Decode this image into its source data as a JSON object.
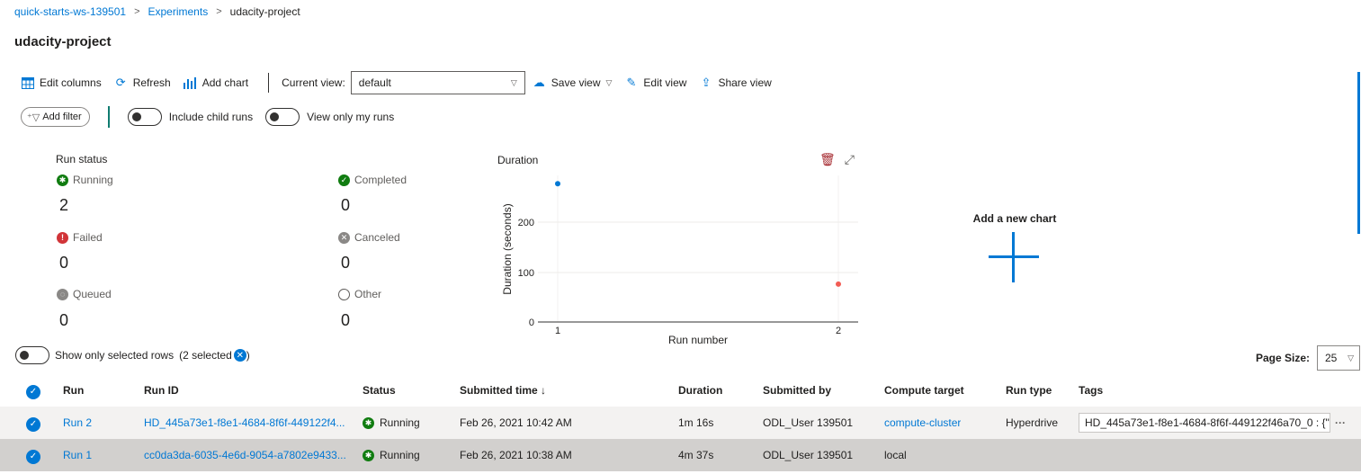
{
  "breadcrumb": {
    "workspace": "quick-starts-ws-139501",
    "experiments": "Experiments",
    "current": "udacity-project"
  },
  "page_title": "udacity-project",
  "toolbar": {
    "edit_columns": "Edit columns",
    "refresh": "Refresh",
    "add_chart": "Add chart",
    "current_view_label": "Current view:",
    "current_view_value": "default",
    "save_view": "Save view",
    "edit_view": "Edit view",
    "share_view": "Share view"
  },
  "filterbar": {
    "add_filter": "Add filter",
    "include_child_runs": "Include child runs",
    "view_only_my_runs": "View only my runs"
  },
  "run_status": {
    "title": "Run status",
    "running_label": "Running",
    "running_count": "2",
    "completed_label": "Completed",
    "completed_count": "0",
    "failed_label": "Failed",
    "failed_count": "0",
    "canceled_label": "Canceled",
    "canceled_count": "0",
    "queued_label": "Queued",
    "queued_count": "0",
    "other_label": "Other",
    "other_count": "0"
  },
  "duration_chart": {
    "title": "Duration",
    "ylabel": "Duration (seconds)",
    "xlabel": "Run number",
    "yticks": [
      "0",
      "100",
      "200"
    ],
    "xticks": [
      "1",
      "2"
    ]
  },
  "chart_data": {
    "type": "scatter",
    "title": "Duration",
    "xlabel": "Run number",
    "ylabel": "Duration (seconds)",
    "x": [
      1,
      2
    ],
    "y": [
      277,
      76
    ],
    "point_colors": [
      "#0078d4",
      "#f25c54"
    ],
    "ylim": [
      0,
      300
    ],
    "xlim": [
      1,
      2
    ]
  },
  "add_new_chart": "Add a new chart",
  "selection": {
    "show_only_selected": "Show only selected rows",
    "selected_count": "(2 selected",
    "close_paren": ")"
  },
  "page_size": {
    "label": "Page Size:",
    "value": "25"
  },
  "table": {
    "headers": {
      "run": "Run",
      "run_id": "Run ID",
      "status": "Status",
      "submitted_time": "Submitted time ↓",
      "duration": "Duration",
      "submitted_by": "Submitted by",
      "compute_target": "Compute target",
      "run_type": "Run type",
      "tags": "Tags"
    },
    "rows": [
      {
        "run": "Run 2",
        "run_id": "HD_445a73e1-f8e1-4684-8f6f-449122f4...",
        "status": "Running",
        "submitted_time": "Feb 26, 2021 10:42 AM",
        "duration": "1m 16s",
        "submitted_by": "ODL_User 139501",
        "compute_target": "compute-cluster",
        "run_type": "Hyperdrive",
        "tags": "HD_445a73e1-f8e1-4684-8f6f-449122f46a70_0 : {\""
      },
      {
        "run": "Run 1",
        "run_id": "cc0da3da-6035-4e6d-9054-a7802e9433...",
        "status": "Running",
        "submitted_time": "Feb 26, 2021 10:38 AM",
        "duration": "4m 37s",
        "submitted_by": "ODL_User 139501",
        "compute_target": "local",
        "run_type": "",
        "tags": ""
      }
    ]
  }
}
